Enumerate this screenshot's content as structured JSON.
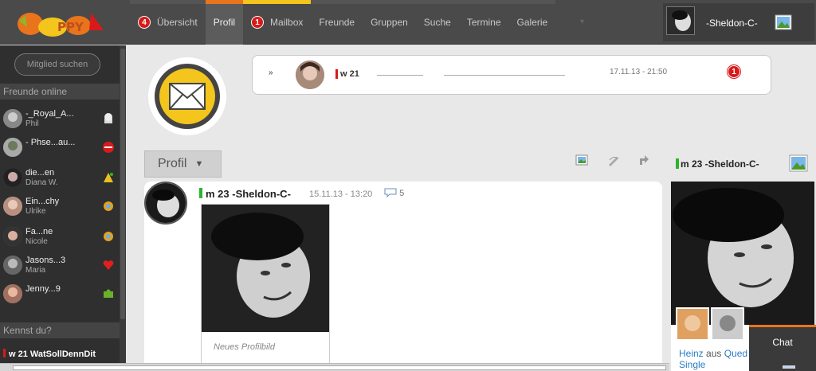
{
  "nav": {
    "items": [
      {
        "label": "Übersicht",
        "badge": "4",
        "accent": "#666666"
      },
      {
        "label": "Profil",
        "badge": "",
        "accent": "#e9741c"
      },
      {
        "label": "Mailbox",
        "badge": "1",
        "accent": "#f3c51d"
      },
      {
        "label": "Freunde",
        "badge": "",
        "accent": "#666666"
      },
      {
        "label": "Gruppen",
        "badge": "",
        "accent": "#666666"
      },
      {
        "label": "Suche",
        "badge": "",
        "accent": "#666666"
      },
      {
        "label": "Termine",
        "badge": "",
        "accent": "#666666"
      },
      {
        "label": "Galerie",
        "badge": "",
        "accent": "#666666"
      }
    ]
  },
  "user": {
    "name": "-Sheldon-C-"
  },
  "sidebar": {
    "search_label": "Mitglied suchen",
    "online_heading": "Freunde online",
    "friends": [
      {
        "name": "-_Royal_A...",
        "real": "Phil",
        "icon": "chef-hat-icon"
      },
      {
        "name": "- Phse...au...",
        "real": "",
        "icon": "no-entry-icon"
      },
      {
        "name": "die...en",
        "real": "Diana W.",
        "icon": "party-icon"
      },
      {
        "name": "Ein...chy",
        "real": "Ulrike",
        "icon": "gear-flower-icon"
      },
      {
        "name": "Fa...ne",
        "real": "Nicole",
        "icon": "gear-flower-icon"
      },
      {
        "name": "Jasons...3",
        "real": "Maria",
        "icon": "heart-icon"
      },
      {
        "name": "Jenny...9",
        "real": "",
        "icon": "puzzle-icon"
      }
    ],
    "kennst_du_heading": "Kennst du?",
    "suggestion": "w 21 WatSollDennDit"
  },
  "message": {
    "user": "w 21",
    "time": "17.11.13 - 21:50",
    "badge": "1"
  },
  "profile_button": "Profil",
  "post": {
    "user": "m 23 -Sheldon-C-",
    "date": "15.11.13 - 13:20",
    "comments": "5",
    "caption": "Neues Profilbild"
  },
  "right_column": {
    "user": "m 23 -Sheldon-C-",
    "friend_link": "Heinz",
    "friend_text": "aus",
    "friend_place": "Qued",
    "friend_status": "Single"
  },
  "chat": {
    "label": "Chat"
  },
  "colors": {
    "accent_orange": "#e9741c",
    "badge_red": "#d81a1a",
    "online_green": "#2bb52b",
    "link_blue": "#2a7dc4"
  }
}
